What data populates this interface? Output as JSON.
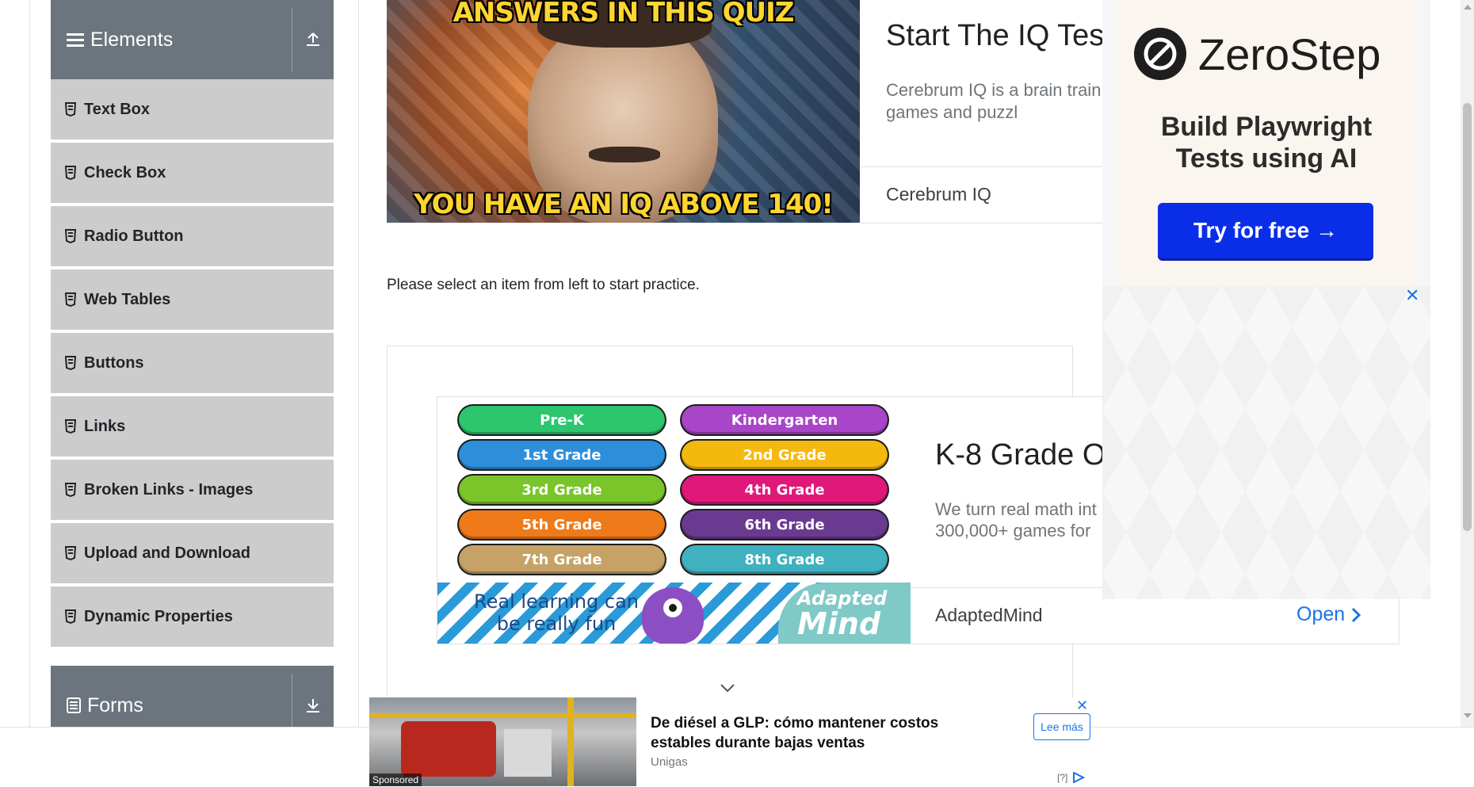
{
  "sidebar": {
    "elements_header": {
      "title": "Elements",
      "toggle_icon": "arrow-up-tray-icon"
    },
    "items": [
      {
        "label": "Text Box"
      },
      {
        "label": "Check Box"
      },
      {
        "label": "Radio Button"
      },
      {
        "label": "Web Tables"
      },
      {
        "label": "Buttons"
      },
      {
        "label": "Links"
      },
      {
        "label": "Broken Links - Images"
      },
      {
        "label": "Upload and Download"
      },
      {
        "label": "Dynamic Properties"
      }
    ],
    "forms_header": {
      "title": "Forms",
      "toggle_icon": "arrow-down-tray-icon"
    },
    "colors": {
      "header_bg": "#6c757d",
      "item_bg": "#cccccc"
    }
  },
  "main": {
    "practice_text": "Please select an item from left to start practice."
  },
  "ad_top": {
    "caption_top": "ANSWERS IN THIS QUIZ",
    "caption_bottom": "YOU HAVE AN IQ ABOVE 140!",
    "headline": "Start The IQ Test",
    "body": "Cerebrum IQ is a brain train variety of games and puzzl",
    "advertiser": "Cerebrum IQ"
  },
  "ad_mid": {
    "grades": [
      {
        "label": "Pre-K",
        "color": "#2bc66e"
      },
      {
        "label": "Kindergarten",
        "color": "#a845c9"
      },
      {
        "label": "1st Grade",
        "color": "#2d8fdb"
      },
      {
        "label": "2nd Grade",
        "color": "#f5b80f"
      },
      {
        "label": "3rd Grade",
        "color": "#7ac52a"
      },
      {
        "label": "4th Grade",
        "color": "#e0187a"
      },
      {
        "label": "5th Grade",
        "color": "#ef7a1a"
      },
      {
        "label": "6th Grade",
        "color": "#6a3a90"
      },
      {
        "label": "7th Grade",
        "color": "#c6a266"
      },
      {
        "label": "8th Grade",
        "color": "#3fb1bf"
      }
    ],
    "banner_text_1": "Real learning can",
    "banner_text_2": "be really fun",
    "banner_logo_1": "Adapted",
    "banner_logo_2": "Mind",
    "headline": "K-8 Grade O",
    "body_line1": "We turn real math int",
    "body_line2": "300,000+ games for",
    "advertiser": "AdaptedMind",
    "open_label": "Open"
  },
  "ad_right": {
    "brand": "ZeroStep",
    "headline_line1": "Build Playwright",
    "headline_line2": "Tests using AI",
    "cta": "Try for free →",
    "close": "✕",
    "cta_color": "#0a2ee8"
  },
  "ad_bottom": {
    "sponsored": "Sponsored",
    "title": "De diésel a GLP: cómo mantener costos estables durante bajas ventas",
    "advertiser": "Unigas",
    "more": "Lee más",
    "close": "✕",
    "info": "[?]"
  }
}
